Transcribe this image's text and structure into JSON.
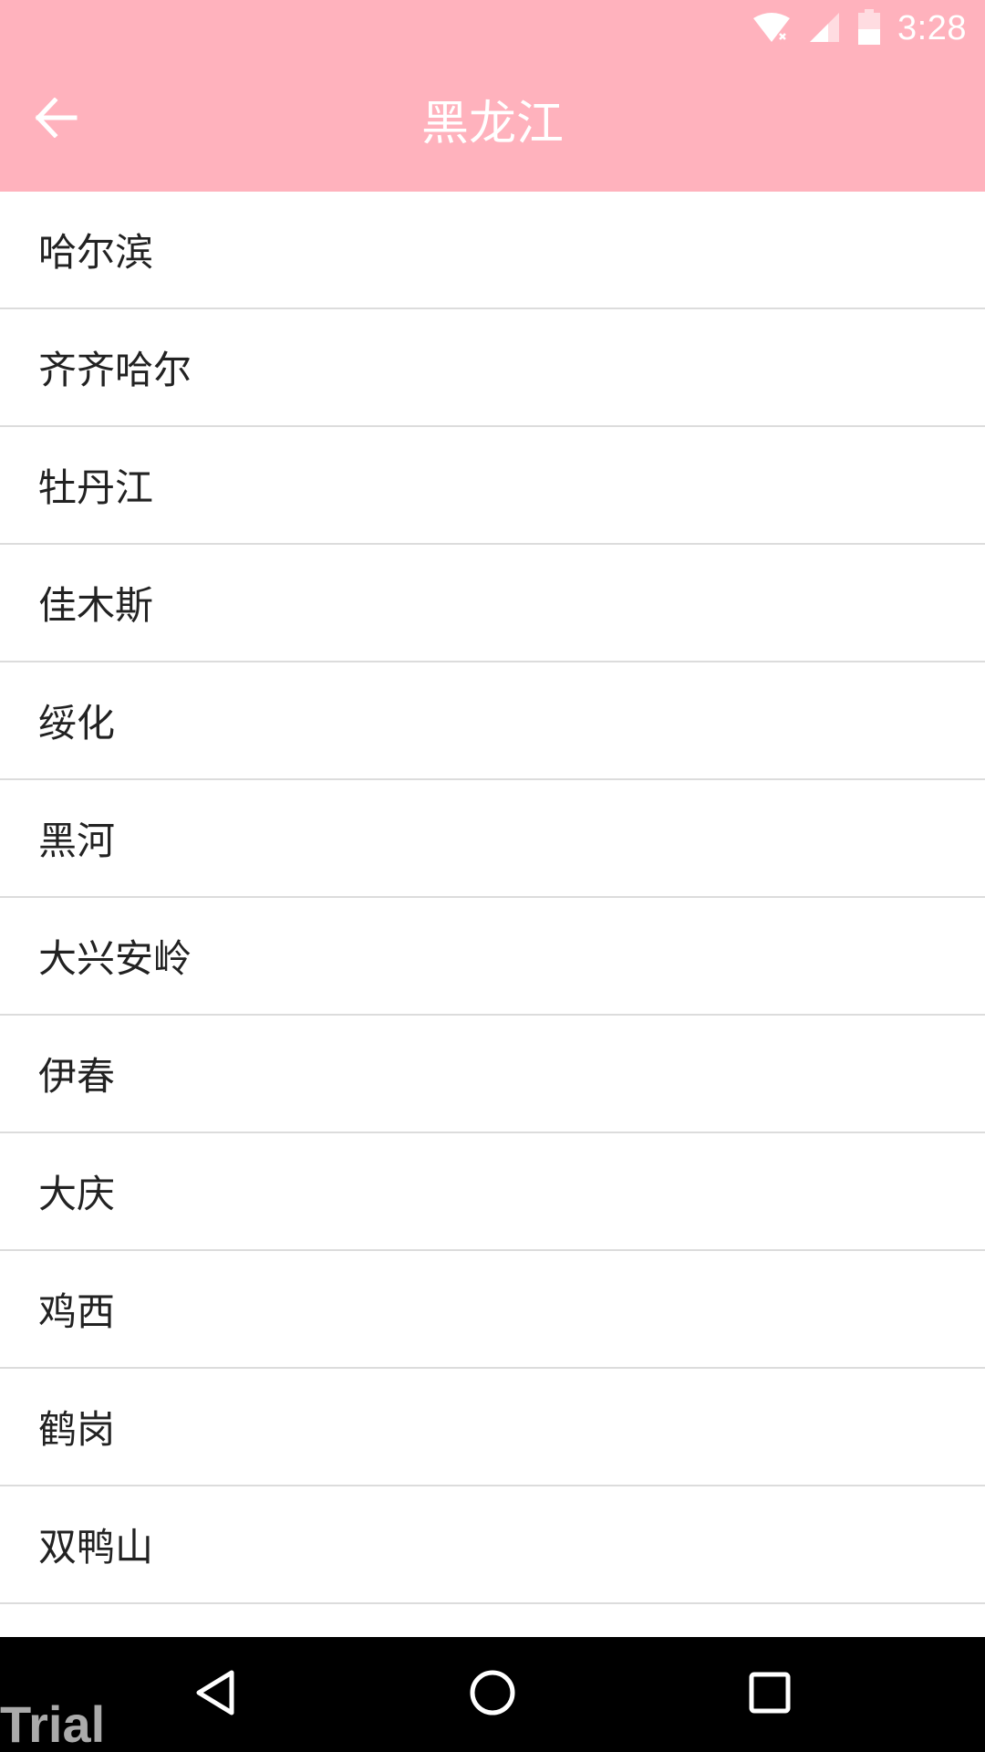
{
  "status_bar": {
    "time": "3:28",
    "icons": [
      "wifi-off-icon",
      "cell-signal-icon",
      "battery-icon"
    ]
  },
  "app_bar": {
    "title": "黑龙江",
    "back_icon": "arrow-left-icon"
  },
  "cities": [
    {
      "label": "哈尔滨"
    },
    {
      "label": "齐齐哈尔"
    },
    {
      "label": "牡丹江"
    },
    {
      "label": "佳木斯"
    },
    {
      "label": "绥化"
    },
    {
      "label": "黑河"
    },
    {
      "label": "大兴安岭"
    },
    {
      "label": "伊春"
    },
    {
      "label": "大庆"
    },
    {
      "label": "鸡西"
    },
    {
      "label": "鹤岗"
    },
    {
      "label": "双鸭山"
    }
  ],
  "nav_bar": {
    "icons": [
      "back-triangle-icon",
      "home-circle-icon",
      "recents-square-icon"
    ]
  },
  "watermark": "Trial",
  "colors": {
    "accent": "#ffb2bd",
    "text": "#222222",
    "divider": "#dcdcdc",
    "nav_bg": "#000000"
  }
}
